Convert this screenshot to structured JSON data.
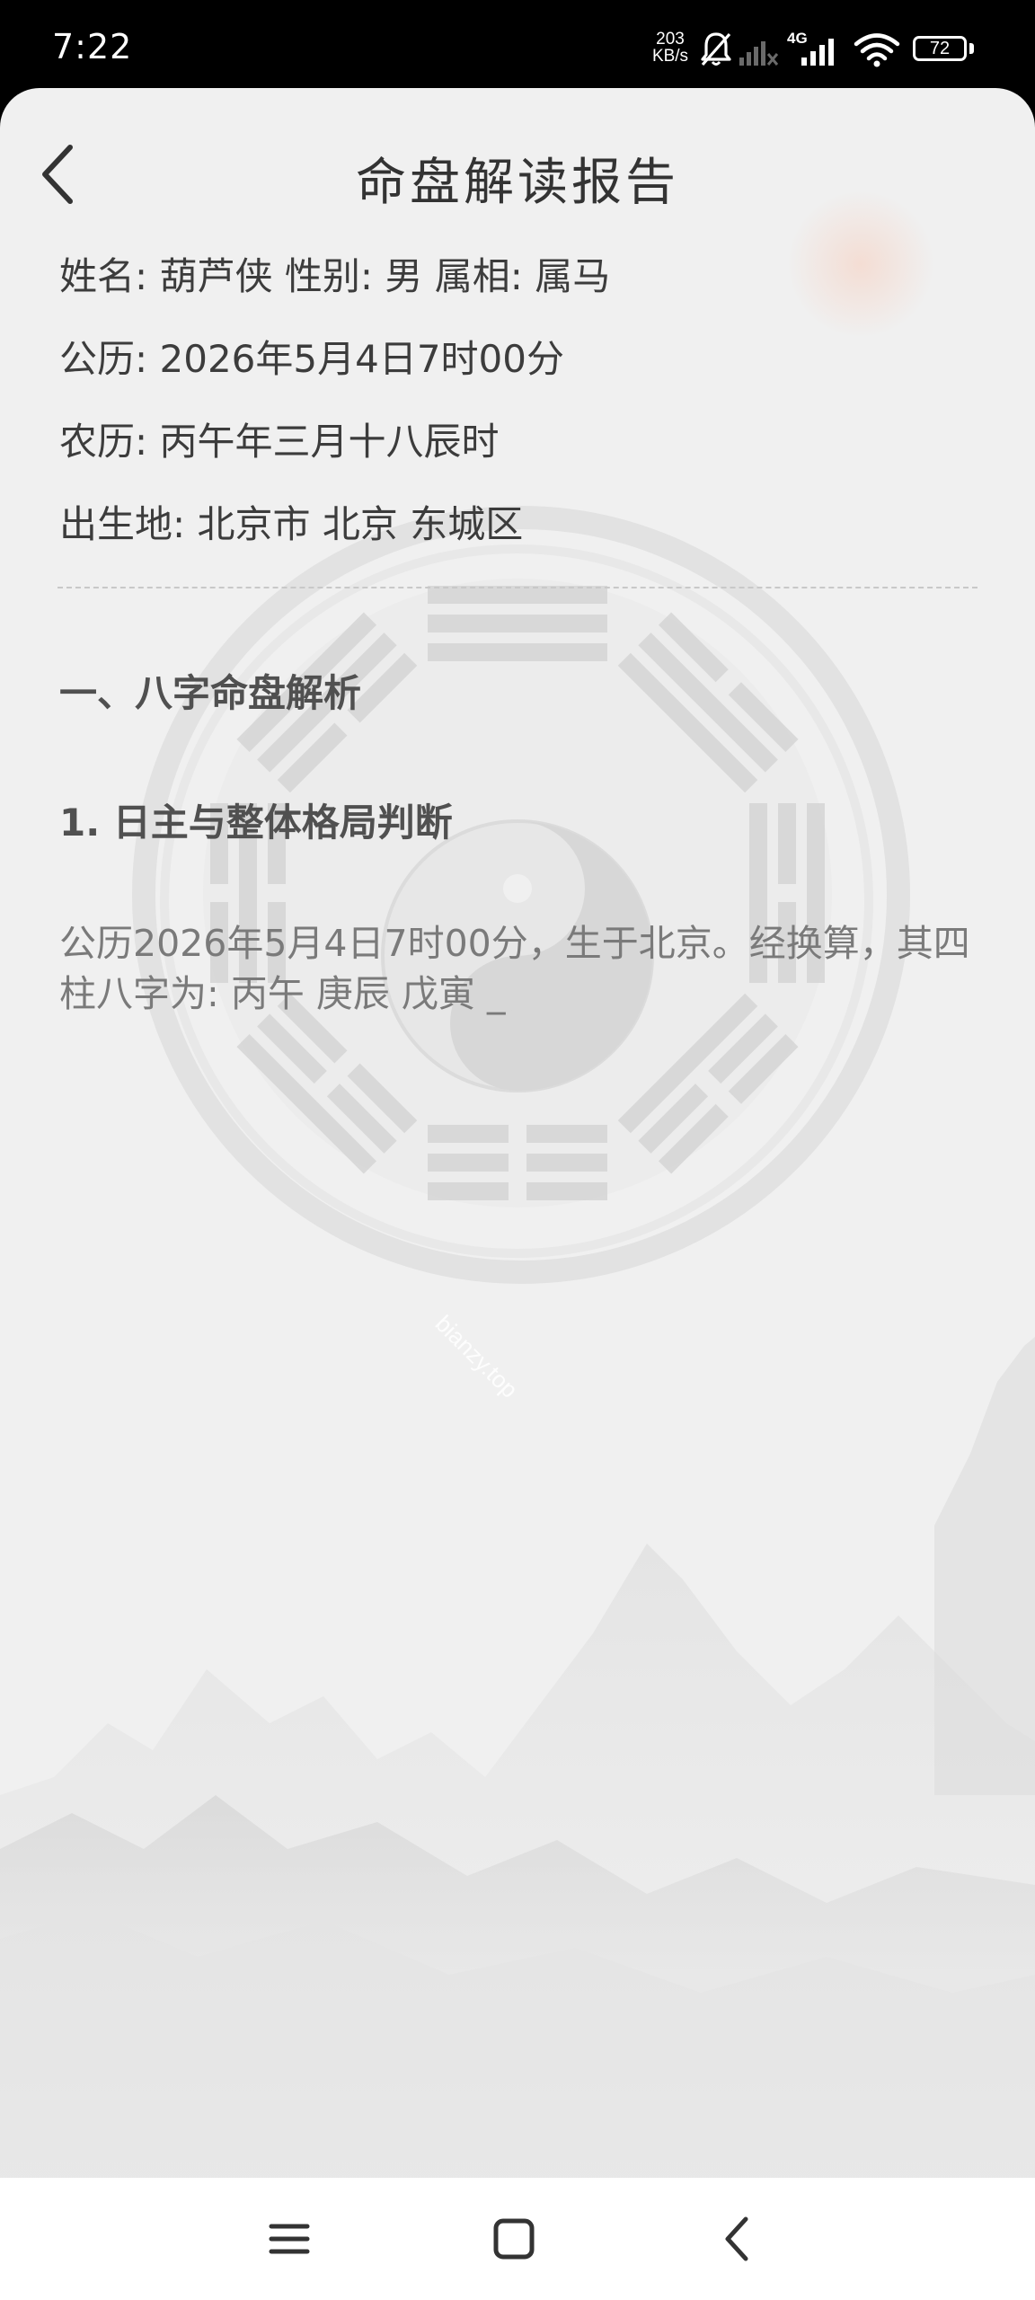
{
  "status_bar": {
    "time": "7:22",
    "net_speed_value": "203",
    "net_speed_unit": "KB/s",
    "network_type": "4G",
    "battery_level": "72",
    "icons": [
      "notifications-muted-icon",
      "signal-no-service-icon",
      "signal-4g-icon",
      "wifi-icon",
      "battery-icon"
    ]
  },
  "header": {
    "title": "命盘解读报告",
    "back_icon": "chevron-left-icon"
  },
  "profile": {
    "name_line": "姓名: 葫芦侠 性别: 男 属相: 属马",
    "solar_line": "公历: 2026年5月4日7时00分",
    "lunar_line": "农历: 丙午年三月十八辰时",
    "birthplace_line": "出生地: 北京市 北京 东城区"
  },
  "report": {
    "section_heading": "一、八字命盘解析",
    "sub_heading": "1. 日主与整体格局判断",
    "body": "公历2026年5月4日7时00分，生于北京。经换算，其四柱八字为: 丙午 庚辰 戊寅 _"
  },
  "watermark": "bianzy.top",
  "nav_bar": {
    "icons": [
      "menu-icon",
      "home-icon",
      "back-icon"
    ]
  },
  "colors": {
    "status_bar_bg": "#000000",
    "sheet_bg": "#f0f0f0",
    "title_text": "#333333",
    "body_text": "#7a7a7a",
    "sun_accent": "#f3d9cf"
  }
}
